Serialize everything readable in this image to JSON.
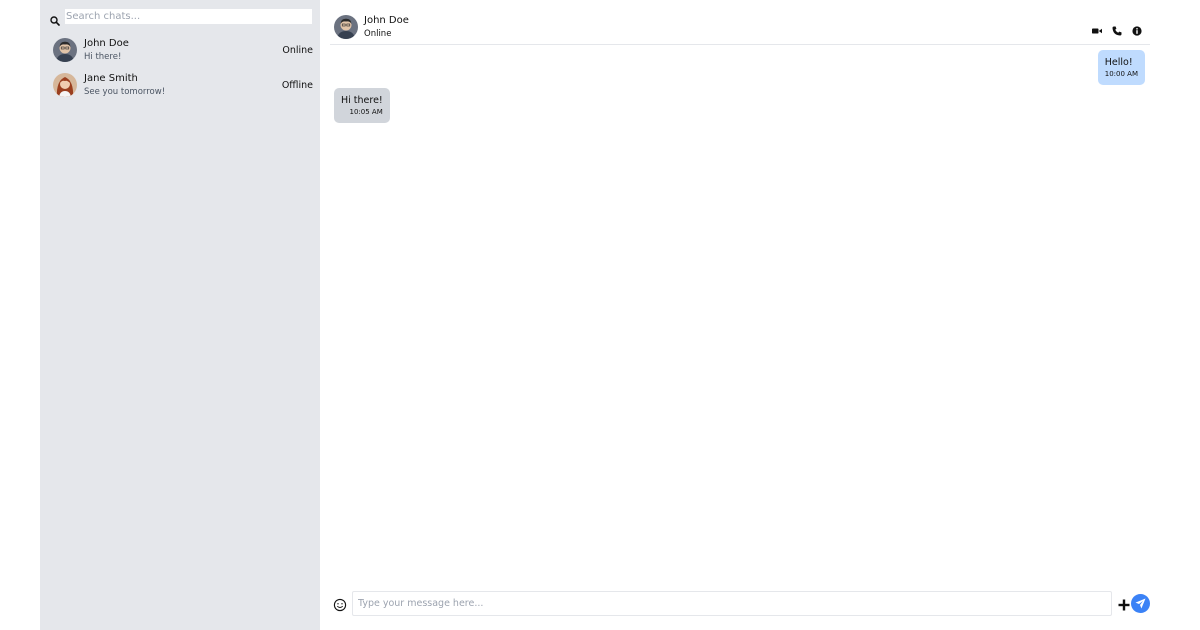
{
  "sidebar": {
    "search": {
      "placeholder": "Search chats...",
      "icon": "search-icon"
    },
    "chats": [
      {
        "name": "John Doe",
        "preview": "Hi there!",
        "status": "Online"
      },
      {
        "name": "Jane Smith",
        "preview": "See you tomorrow!",
        "status": "Offline"
      }
    ]
  },
  "header": {
    "name": "John Doe",
    "status": "Online",
    "actions": [
      "video-call-icon",
      "phone-icon",
      "info-icon"
    ]
  },
  "messages": [
    {
      "direction": "sent",
      "text": "Hello!",
      "time": "10:00 AM"
    },
    {
      "direction": "received",
      "text": "Hi there!",
      "time": "10:05 AM"
    }
  ],
  "composer": {
    "placeholder": "Type your message here...",
    "icons": [
      "emoji-icon",
      "plus-icon",
      "send-icon"
    ]
  },
  "colors": {
    "sidebar_bg": "#e5e7eb",
    "sent_bubble": "#bfdbfe",
    "received_bubble": "#d1d5db",
    "send_button": "#3b82f6"
  }
}
